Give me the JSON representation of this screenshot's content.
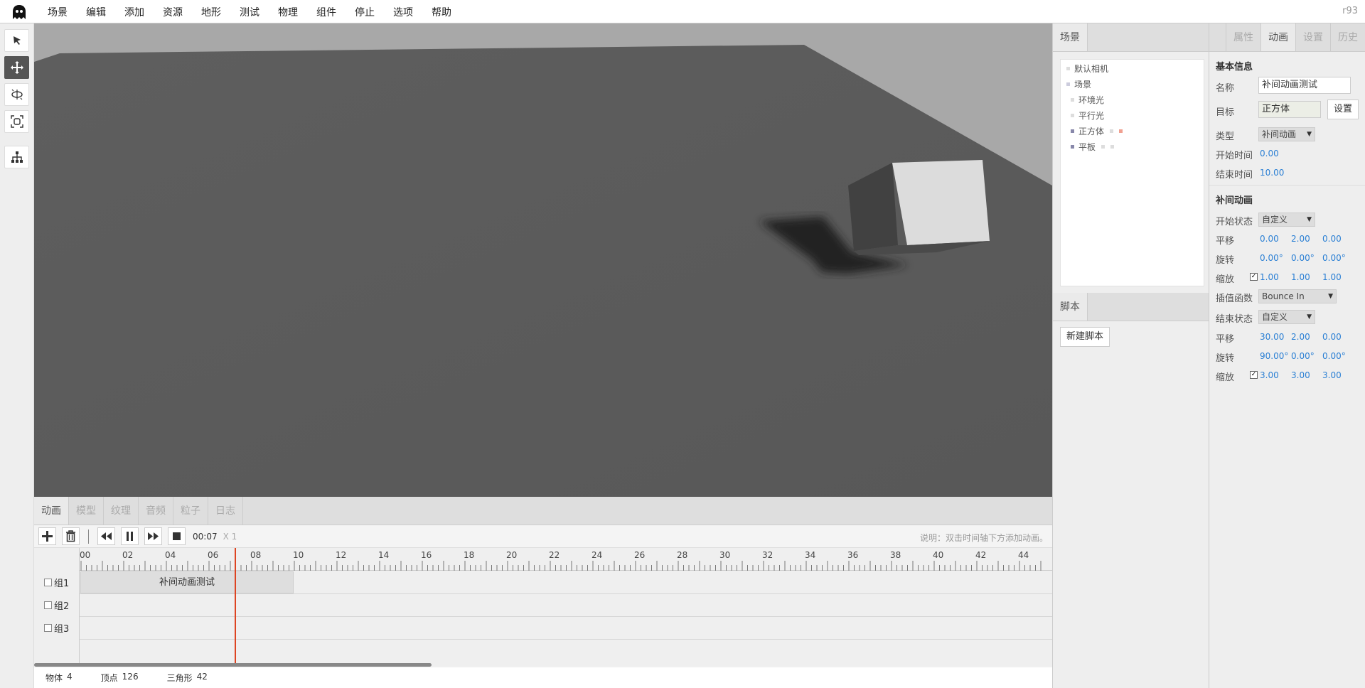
{
  "app": {
    "version": "r93"
  },
  "menubar": {
    "items": [
      "场景",
      "编辑",
      "添加",
      "资源",
      "地形",
      "测试",
      "物理",
      "组件",
      "停止",
      "选项",
      "帮助"
    ]
  },
  "toolbar": {
    "tools": [
      "select-icon",
      "translate-icon",
      "rotate-icon",
      "scale-icon",
      "hierarchy-icon"
    ],
    "active_index": 1
  },
  "bottom_panel": {
    "tabs": [
      "动画",
      "模型",
      "纹理",
      "音频",
      "粒子",
      "日志"
    ],
    "active_tab": 0,
    "time": "00:07",
    "speed": "X 1",
    "hint": "说明：双击时间轴下方添加动画。",
    "ruler_labels": [
      "00",
      "02",
      "04",
      "06",
      "08",
      "10",
      "12",
      "14",
      "16",
      "18",
      "20",
      "22",
      "24",
      "26",
      "28",
      "30",
      "32",
      "34",
      "36",
      "38",
      "40",
      "42",
      "44"
    ],
    "groups": [
      "组1",
      "组2",
      "组3"
    ],
    "clip_label": "补间动画测试",
    "playhead_time": 7.2
  },
  "statusbar": {
    "objects_label": "物体",
    "objects_value": "4",
    "vertices_label": "顶点",
    "vertices_value": "126",
    "triangles_label": "三角形",
    "triangles_value": "42"
  },
  "outline_panel": {
    "tab": "场景",
    "items": [
      {
        "label": "默认相机",
        "indent": 0
      },
      {
        "label": "场景",
        "indent": 0
      },
      {
        "label": "环境光",
        "indent": 1
      },
      {
        "label": "平行光",
        "indent": 1
      },
      {
        "label": "正方体",
        "indent": 1
      },
      {
        "label": "平板",
        "indent": 1
      }
    ]
  },
  "script_panel": {
    "tab": "脚本",
    "new_button": "新建脚本"
  },
  "properties": {
    "tabs": [
      "属性",
      "动画",
      "设置",
      "历史"
    ],
    "active_tab": 1,
    "basic_title": "基本信息",
    "name_label": "名称",
    "name_value": "补间动画测试",
    "target_label": "目标",
    "target_value": "正方体",
    "set_button": "设置",
    "type_label": "类型",
    "type_value": "补间动画",
    "start_time_label": "开始时间",
    "start_time_value": "0.00",
    "end_time_label": "结束时间",
    "end_time_value": "10.00",
    "tween_title": "补间动画",
    "start_state_label": "开始状态",
    "start_state_value": "自定义",
    "translate_label": "平移",
    "rotate_label": "旋转",
    "scale_label": "缩放",
    "start_translate": [
      "0.00",
      "2.00",
      "0.00"
    ],
    "start_rotate": [
      "0.00°",
      "0.00°",
      "0.00°"
    ],
    "start_scale": [
      "1.00",
      "1.00",
      "1.00"
    ],
    "ease_label": "插值函数",
    "ease_value": "Bounce In",
    "end_state_label": "结束状态",
    "end_state_value": "自定义",
    "end_translate": [
      "30.00",
      "2.00",
      "0.00"
    ],
    "end_rotate": [
      "90.00°",
      "0.00°",
      "0.00°"
    ],
    "end_scale": [
      "3.00",
      "3.00",
      "3.00"
    ]
  }
}
